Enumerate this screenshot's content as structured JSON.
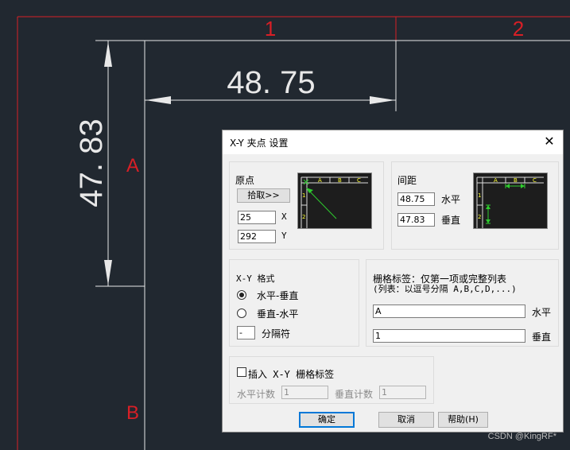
{
  "cad": {
    "col_label_1": "1",
    "col_label_2": "2",
    "row_label_a": "A",
    "row_label_b": "B",
    "dim_horizontal": "48. 75",
    "dim_vertical": "47. 83",
    "grid_color": "#d81f26",
    "line_color": "#e8e8e8"
  },
  "dialog": {
    "title": "X-Y 夹点 设置",
    "close_icon": "close-icon",
    "origin": {
      "label": "原点",
      "pick_button": "拾取>>",
      "x_value": "25",
      "x_label": "X",
      "y_value": "292",
      "y_label": "Y"
    },
    "spacing": {
      "label": "间距",
      "h_value": "48.75",
      "h_label": "水平",
      "v_value": "47.83",
      "v_label": "垂直"
    },
    "preview_labels": [
      "A",
      "B",
      "C",
      "1",
      "2"
    ],
    "format": {
      "label": "X-Y 格式",
      "option_1": "水平-垂直",
      "option_2": "垂直-水平",
      "separator_value": "-",
      "separator_label": "分隔符"
    },
    "grid_labels": {
      "line1": "栅格标签：仅第一项或完整列表",
      "line2": "(列表：以逗号分隔 A,B,C,D,...)",
      "h_value": "A",
      "h_label": "水平",
      "v_value": "1",
      "v_label": "垂直"
    },
    "insert": {
      "label": "插入 X-Y 栅格标签",
      "h_count_label": "水平计数",
      "h_count_value": "1",
      "v_count_label": "垂直计数",
      "v_count_value": "1"
    },
    "buttons": {
      "ok": "确定",
      "cancel": "取消",
      "help": "帮助(H)"
    }
  },
  "watermark": "CSDN @KingRF*"
}
